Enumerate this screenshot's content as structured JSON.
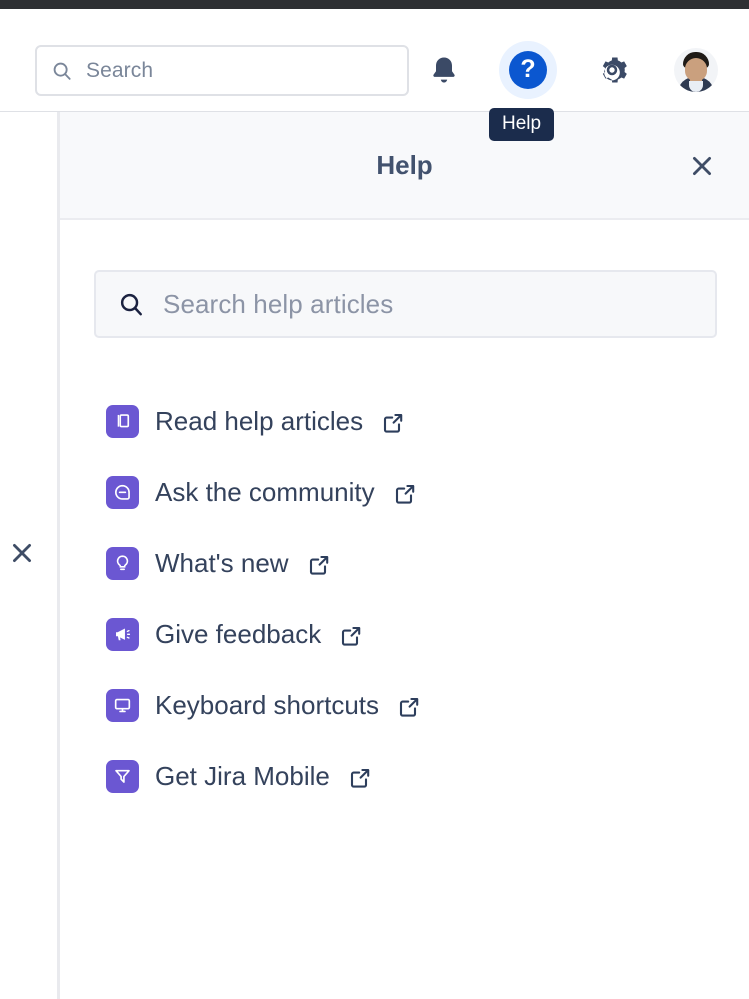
{
  "navbar": {
    "search": {
      "placeholder": "Search",
      "value": "",
      "icon": "search-icon"
    },
    "icons": [
      {
        "name": "notifications-icon",
        "label": "Notifications"
      },
      {
        "name": "help-icon",
        "label": "Help",
        "glyph": "?",
        "active": true,
        "active_bg": "#E9F2FF",
        "circle_color": "#0B57D0"
      },
      {
        "name": "settings-gear-icon",
        "label": "Settings"
      },
      {
        "name": "avatar",
        "label": "Your profile and settings"
      }
    ]
  },
  "tooltip": {
    "text": "Help"
  },
  "left_rail": {
    "close_icon": "close-icon",
    "close_label": "Close"
  },
  "panel": {
    "title": "Help",
    "close_icon": "close-icon",
    "search": {
      "placeholder": "Search help articles",
      "value": "",
      "icon": "search-icon"
    },
    "items": [
      {
        "label": "Read help articles",
        "icon": "documents-icon",
        "external": true
      },
      {
        "label": "Ask the community",
        "icon": "comment-bubble-icon",
        "external": true
      },
      {
        "label": "What's new",
        "icon": "lightbulb-icon",
        "external": true
      },
      {
        "label": "Give feedback",
        "icon": "megaphone-icon",
        "external": true
      },
      {
        "label": "Keyboard shortcuts",
        "icon": "monitor-icon",
        "external": true
      },
      {
        "label": "Get Jira Mobile",
        "icon": "jira-mobile-icon",
        "external": true
      }
    ]
  },
  "colors": {
    "icon_tile_purple": "#6B57D2",
    "text_navy": "#34425C",
    "help_blue": "#0B57D0",
    "tooltip_bg": "#1B2C4C",
    "panel_header_bg": "#F8F9FB"
  }
}
